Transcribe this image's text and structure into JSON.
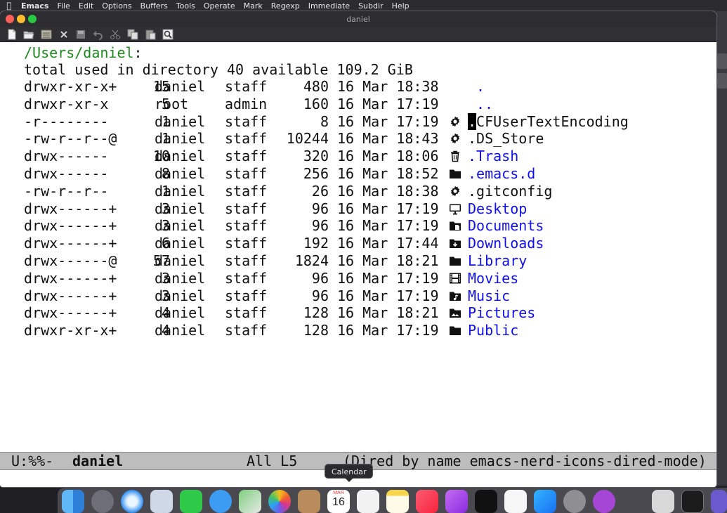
{
  "menubar": {
    "items": [
      "Emacs",
      "File",
      "Edit",
      "Options",
      "Buffers",
      "Tools",
      "Operate",
      "Mark",
      "Regexp",
      "Immediate",
      "Subdir",
      "Help"
    ]
  },
  "window": {
    "title": "daniel",
    "toolbar_icons": [
      "new-file-icon",
      "open-folder-icon",
      "dired-icon",
      "close-icon",
      "save-icon",
      "undo-icon",
      "cut-icon",
      "copy-icon",
      "paste-icon",
      "search-icon"
    ]
  },
  "dired": {
    "path": "/Users/daniel",
    "path_colon": ":",
    "total_line": "total used in directory 40 available 109.2 GiB",
    "entries": [
      {
        "perm": "drwxr-xr-x+",
        "links": "15",
        "owner": "daniel",
        "group": "staff",
        "size": "480",
        "date": "16 Mar 18:38",
        "icon": "none",
        "name": ".",
        "color": "blue"
      },
      {
        "perm": "drwxr-xr-x",
        "links": "5",
        "owner": "root",
        "group": "admin",
        "size": "160",
        "date": "16 Mar 17:19",
        "icon": "none",
        "name": "..",
        "color": "blue"
      },
      {
        "perm": "-r--------",
        "links": "1",
        "owner": "daniel",
        "group": "staff",
        "size": "8",
        "date": "16 Mar 17:19",
        "icon": "gear-icon",
        "name": ".CFUserTextEncoding",
        "color": "dark"
      },
      {
        "perm": "-rw-r--r--@",
        "links": "1",
        "owner": "daniel",
        "group": "staff",
        "size": "10244",
        "date": "16 Mar 18:43",
        "icon": "gear-icon",
        "name": ".DS_Store",
        "color": "dark"
      },
      {
        "perm": "drwx------",
        "links": "10",
        "owner": "daniel",
        "group": "staff",
        "size": "320",
        "date": "16 Mar 18:06",
        "icon": "trash-icon",
        "name": ".Trash",
        "color": "blue"
      },
      {
        "perm": "drwx------",
        "links": "8",
        "owner": "daniel",
        "group": "staff",
        "size": "256",
        "date": "16 Mar 18:52",
        "icon": "folder-icon",
        "name": ".emacs.d",
        "color": "blue"
      },
      {
        "perm": "-rw-r--r--",
        "links": "1",
        "owner": "daniel",
        "group": "staff",
        "size": "26",
        "date": "16 Mar 18:38",
        "icon": "gear-icon",
        "name": ".gitconfig",
        "color": "dark"
      },
      {
        "perm": "drwx------+",
        "links": "3",
        "owner": "daniel",
        "group": "staff",
        "size": "96",
        "date": "16 Mar 17:19",
        "icon": "desktop-icon",
        "name": "Desktop",
        "color": "blue"
      },
      {
        "perm": "drwx------+",
        "links": "3",
        "owner": "daniel",
        "group": "staff",
        "size": "96",
        "date": "16 Mar 17:19",
        "icon": "documents-icon",
        "name": "Documents",
        "color": "blue"
      },
      {
        "perm": "drwx------+",
        "links": "6",
        "owner": "daniel",
        "group": "staff",
        "size": "192",
        "date": "16 Mar 17:44",
        "icon": "downloads-icon",
        "name": "Downloads",
        "color": "blue"
      },
      {
        "perm": "drwx------@",
        "links": "57",
        "owner": "daniel",
        "group": "staff",
        "size": "1824",
        "date": "16 Mar 18:21",
        "icon": "folder-icon",
        "name": "Library",
        "color": "blue"
      },
      {
        "perm": "drwx------+",
        "links": "3",
        "owner": "daniel",
        "group": "staff",
        "size": "96",
        "date": "16 Mar 17:19",
        "icon": "film-icon",
        "name": "Movies",
        "color": "blue"
      },
      {
        "perm": "drwx------+",
        "links": "3",
        "owner": "daniel",
        "group": "staff",
        "size": "96",
        "date": "16 Mar 17:19",
        "icon": "music-folder-icon",
        "name": "Music",
        "color": "blue"
      },
      {
        "perm": "drwx------+",
        "links": "4",
        "owner": "daniel",
        "group": "staff",
        "size": "128",
        "date": "16 Mar 18:21",
        "icon": "pictures-folder-icon",
        "name": "Pictures",
        "color": "blue"
      },
      {
        "perm": "drwxr-xr-x+",
        "links": "4",
        "owner": "daniel",
        "group": "staff",
        "size": "128",
        "date": "16 Mar 17:19",
        "icon": "folder-icon",
        "name": "Public",
        "color": "blue"
      }
    ]
  },
  "modeline": {
    "status": "U:%%-",
    "buffer_name": "daniel",
    "position": "All L5",
    "mode": "(Dired by name emacs-nerd-icons-dired-mode)"
  },
  "dock": {
    "tooltip": "Calendar",
    "calendar_month": "MAR",
    "calendar_day": "16",
    "apps": [
      "finder",
      "launchpad",
      "safari",
      "mail",
      "facetime",
      "messages",
      "maps",
      "photos",
      "contacts",
      "calendar",
      "reminders",
      "notes",
      "music",
      "podcasts",
      "tv",
      "news",
      "app-store",
      "system-preferences",
      "feedback-assistant",
      "font-book",
      "terminal"
    ]
  },
  "colors": {
    "header_green": "#1d8a1d",
    "link_blue": "#1010ee",
    "modeline_bg": "#bdbdbd"
  }
}
